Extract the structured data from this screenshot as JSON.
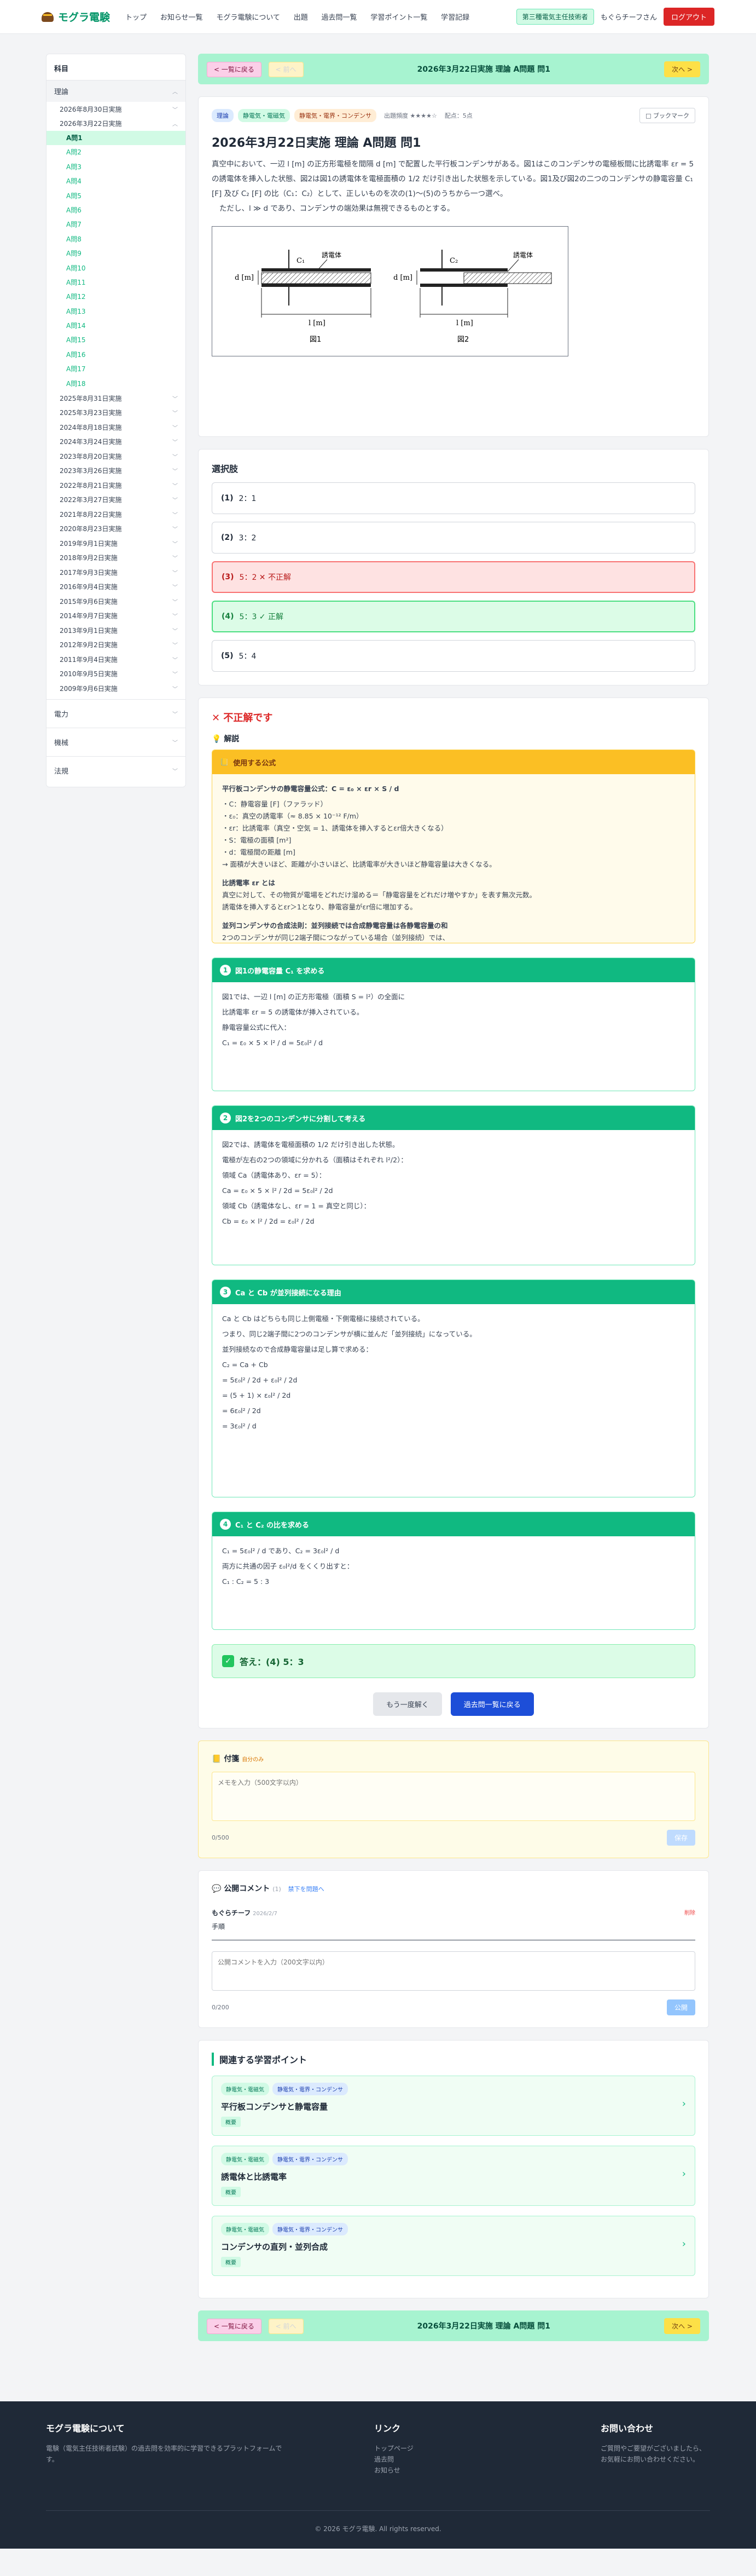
{
  "header": {
    "logo": "モグラ電験",
    "nav": [
      "トップ",
      "お知らせ一覧",
      "モグラ電験について",
      "出題",
      "過去問一覧",
      "学習ポイント一覧",
      "学習記録"
    ],
    "role": "第三種電気主任技術者",
    "user": "もぐらチーフさん",
    "logout": "ログアウト"
  },
  "sidebar": {
    "title": "科目",
    "category_open": "理論",
    "years_top": [
      "2026年8月30日実施",
      "2026年3月22日実施"
    ],
    "questions": [
      "A問1",
      "A問2",
      "A問3",
      "A問4",
      "A問5",
      "A問6",
      "A問7",
      "A問8",
      "A問9",
      "A問10",
      "A問11",
      "A問12",
      "A問13",
      "A問14",
      "A問15",
      "A問16",
      "A問17",
      "A問18"
    ],
    "years_rest": [
      "2025年8月31日実施",
      "2025年3月23日実施",
      "2024年8月18日実施",
      "2024年3月24日実施",
      "2023年8月20日実施",
      "2023年3月26日実施",
      "2022年8月21日実施",
      "2022年3月27日実施",
      "2021年8月22日実施",
      "2020年8月23日実施",
      "2019年9月1日実施",
      "2018年9月2日実施",
      "2017年9月3日実施",
      "2016年9月4日実施",
      "2015年9月6日実施",
      "2014年9月7日実施",
      "2013年9月1日実施",
      "2012年9月2日実施",
      "2011年9月4日実施",
      "2010年9月5日実施",
      "2009年9月6日実施"
    ],
    "categories": [
      "電力",
      "機械",
      "法規"
    ]
  },
  "qnav": {
    "back": "< 一覧に戻る",
    "prev": "< 前へ",
    "title": "2026年3月22日実施 理論 A問題 問1",
    "next": "次へ >"
  },
  "question": {
    "tags": [
      "理論",
      "静電気・電磁気",
      "静電気・電界・コンデンサ"
    ],
    "difficulty": "出題頻度 ★★★★☆",
    "points": "配点：5点",
    "bookmark": "□ ブックマーク",
    "title": "2026年3月22日実施 理論 A問題 問1",
    "body1": "真空中において、一辺 l [m] の正方形電極を間隔 d [m] で配置した平行板コンデンサがある。図1はこのコンデンサの電極板間に比誘電率 εr = 5 の誘電体を挿入した状態、図2は図1の誘電体を電極面積の 1/2 だけ引き出した状態を示している。図1及び図2の二つのコンデンサの静電容量 C₁ [F] 及び C₂ [F] の比（C₁：C₂）として、正しいものを次の(1)〜(5)のうちから一つ選べ。",
    "body2": "ただし、l ≫ d であり、コンデンサの端効果は無視できるものとする。",
    "fig1": "図1",
    "fig2": "図2",
    "fig_label": "誘電体"
  },
  "choices": {
    "title": "選択肢",
    "items": [
      {
        "no": "(1)",
        "text": "2：1"
      },
      {
        "no": "(2)",
        "text": "3：2"
      },
      {
        "no": "(3)",
        "text": "5：2 ✕ 不正解"
      },
      {
        "no": "(4)",
        "text": "5：3 ✓ 正解"
      },
      {
        "no": "(5)",
        "text": "5：4"
      }
    ]
  },
  "explanation": {
    "verdict": "✕ 不正解です",
    "label": "解説",
    "formula_head": "使用する公式",
    "f_title": "平行板コンデンサの静電容量公式：C = ε₀ × εr × S / d",
    "f_lines": [
      "・C：静電容量 [F]（ファラッド）",
      "・ε₀：真空の誘電率（≈ 8.85 × 10⁻¹² F/m）",
      "・εr：比誘電率（真空・空気 = 1、誘電体を挿入するとεr倍大きくなる）",
      "・S：電極の面積 [m²]",
      "・d：電極間の距離 [m]",
      "→ 面積が大きいほど、距離が小さいほど、比誘電率が大きいほど静電容量は大きくなる。"
    ],
    "er_title": "比誘電率 εr とは",
    "er_lines": [
      "真空に対して、その物質が電場をどれだけ溜める＝「静電容量をどれだけ増やすか」を表す無次元数。",
      "誘電体を挿入するとεr＞1となり、静電容量がεr倍に増加する。"
    ],
    "par_title": "並列コンデンサの合成法則：並列接続では合成静電容量は各静電容量の和",
    "par_lines": [
      "2つのコンデンサが同じ2端子間につながっている場合（並列接続）では、",
      "各コンデンサに同じ電圧がかかり、合成静電容量 = Ca + Cb となる。"
    ],
    "steps": [
      {
        "n": "1",
        "head": "図1の静電容量 C₁ を求める",
        "lines": [
          "図1では、一辺 l [m] の正方形電極（面積 S = l²）の全面に",
          "比誘電率 εr = 5 の誘電体が挿入されている。",
          "静電容量公式に代入：",
          "C₁ = ε₀ × 5 × l² / d = 5ε₀l² / d"
        ]
      },
      {
        "n": "2",
        "head": "図2を2つのコンデンサに分割して考える",
        "lines": [
          "図2では、誘電体を電極面積の 1/2 だけ引き出した状態。",
          "電極が左右の2つの領域に分かれる（面積はそれぞれ l²/2）：",
          "領域 Ca（誘電体あり、εr = 5）：",
          "Ca = ε₀ × 5 × l² / 2d = 5ε₀l² / 2d",
          "領域 Cb（誘電体なし、εr = 1 = 真空と同じ）：",
          "Cb = ε₀ × l² / 2d = ε₀l² / 2d"
        ]
      },
      {
        "n": "3",
        "head": "Ca と Cb が並列接続になる理由",
        "lines": [
          "Ca と Cb はどちらも同じ上側電極・下側電極に接続されている。",
          "つまり、同じ2端子間に2つのコンデンサが横に並んだ「並列接続」になっている。",
          "並列接続なので合成静電容量は足し算で求める：",
          "C₂ = Ca + Cb",
          "= 5ε₀l² / 2d + ε₀l² / 2d",
          "= (5 + 1) × ε₀l² / 2d",
          "= 6ε₀l² / 2d",
          "= 3ε₀l² / d"
        ]
      },
      {
        "n": "4",
        "head": "C₁ と C₂ の比を求める",
        "lines": [
          "C₁ = 5ε₀l² / d であり、C₂ = 3ε₀l² / d",
          "両方に共通の因子 ε₀l²/d をくくり出すと：",
          "C₁ : C₂ = 5 : 3"
        ]
      }
    ],
    "answer": "答え：(4) 5：3",
    "retry": "もう一度解く",
    "back_list": "過去問一覧に戻る"
  },
  "memo": {
    "title": "付箋",
    "sub": "自分のみ",
    "placeholder": "メモを入力（500文字以内）",
    "count": "0/500",
    "save": "保存"
  },
  "comments": {
    "title": "公開コメント",
    "count": "(1)",
    "policy": "禁下を問題へ",
    "item": {
      "user": "もぐらチーフ",
      "date": "2026/2/7",
      "text": "手順",
      "delete": "削除"
    },
    "placeholder": "公開コメントを入力（200文字以内）",
    "count_text": "0/200",
    "post": "公開"
  },
  "related": {
    "title": "関連する学習ポイント",
    "items": [
      {
        "tags": [
          "静電気・電磁気",
          "静電気・電界・コンデンサ"
        ],
        "title": "平行板コンデンサと静電容量",
        "chip": "概要"
      },
      {
        "tags": [
          "静電気・電磁気",
          "静電気・電界・コンデンサ"
        ],
        "title": "誘電体と比誘電率",
        "chip": "概要"
      },
      {
        "tags": [
          "静電気・電磁気",
          "静電気・電界・コンデンサ"
        ],
        "title": "コンデンサの直列・並列合成",
        "chip": "概要"
      }
    ]
  },
  "footer": {
    "about_title": "モグラ電験について",
    "about_text": "電験（電気主任技術者試験）の過去問を効率的に学習できるプラットフォームです。",
    "links_title": "リンク",
    "links": [
      "トップページ",
      "過去問",
      "お知らせ"
    ],
    "contact_title": "お問い合わせ",
    "contact_text": "ご質問やご要望がございましたら、お気軽にお問い合わせください。",
    "copyright": "© 2026 モグラ電験. All rights reserved."
  }
}
